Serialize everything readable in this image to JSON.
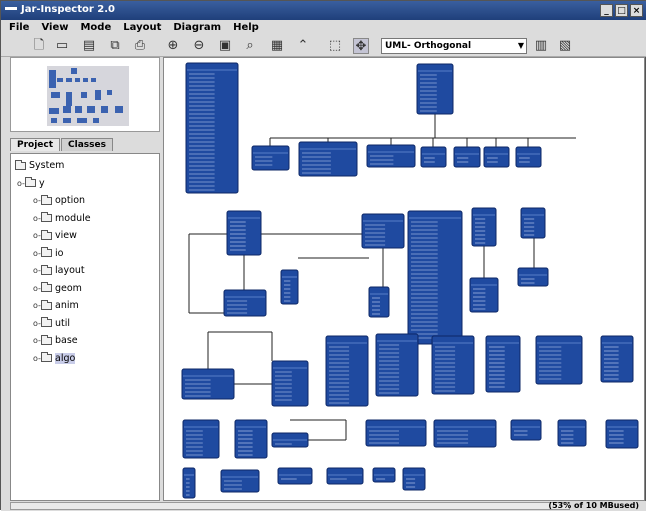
{
  "window": {
    "title": "Jar-Inspector 2.0"
  },
  "menu": [
    "File",
    "View",
    "Mode",
    "Layout",
    "Diagram",
    "Help"
  ],
  "toolbar": {
    "layout_select": "UML- Orthogonal",
    "icons": [
      "new-file-icon",
      "open-folder-icon",
      "save-icon",
      "copy-icon",
      "print-icon",
      "zoom-in-icon",
      "zoom-out-icon",
      "fit-page-icon",
      "zoom-selection-icon",
      "grid-icon",
      "collapse-icon",
      "select-tool-icon",
      "move-tool-icon",
      "layout-options-icon",
      "image-export-icon"
    ]
  },
  "tabs": [
    "Project",
    "Classes"
  ],
  "tree": {
    "root": "System",
    "package": "y",
    "children": [
      "option",
      "module",
      "view",
      "io",
      "layout",
      "geom",
      "anim",
      "util",
      "base",
      "algo"
    ],
    "selected": "algo"
  },
  "status": {
    "text": "(53% of 10 MBused)"
  },
  "colors": {
    "node": "#1f4aa0",
    "node_border": "#0c2766",
    "accent": "#3a5f9f"
  }
}
